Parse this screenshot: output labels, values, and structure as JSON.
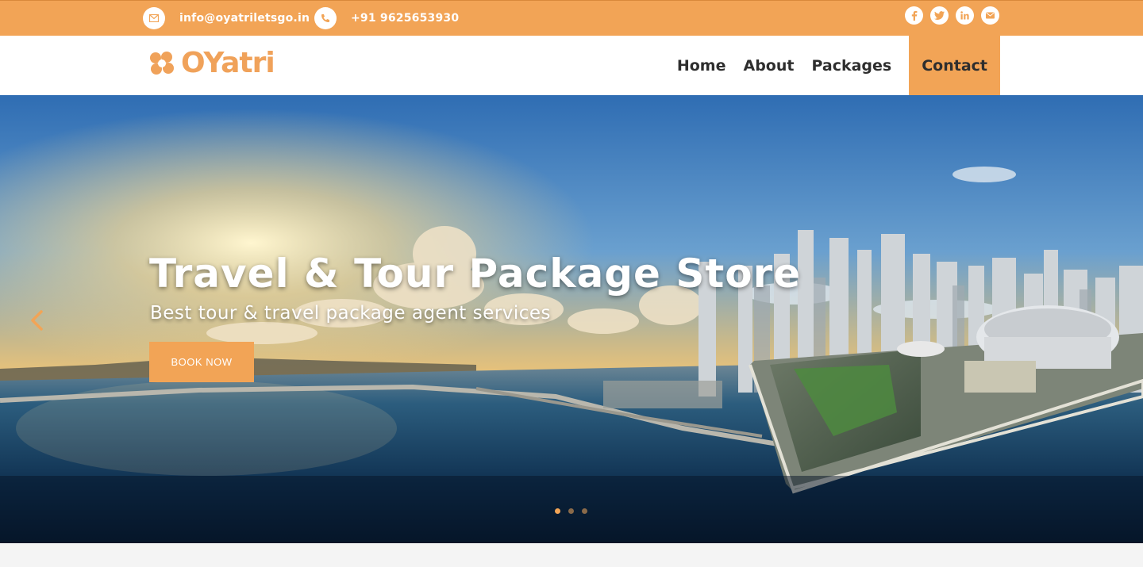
{
  "topbar": {
    "email": "info@oyatriletsgo.in",
    "phone": "+91 9625653930",
    "email_icon": "envelope-icon",
    "phone_icon": "phone-icon",
    "socials": [
      "facebook-icon",
      "twitter-icon",
      "linkedin-icon",
      "mail-icon"
    ]
  },
  "brand": {
    "name": "OYatri",
    "accent": "#f2a456",
    "dark": "#2e2e2e"
  },
  "nav": {
    "items": [
      {
        "label": "Home"
      },
      {
        "label": "About"
      },
      {
        "label": "Packages"
      },
      {
        "label": "Contact"
      }
    ],
    "active": "Contact"
  },
  "hero": {
    "title": "Travel & Tour Package Store",
    "subtitle": "Best tour & travel package agent services",
    "button": "BOOK NOW",
    "slides": 3,
    "active_slide": 1
  }
}
